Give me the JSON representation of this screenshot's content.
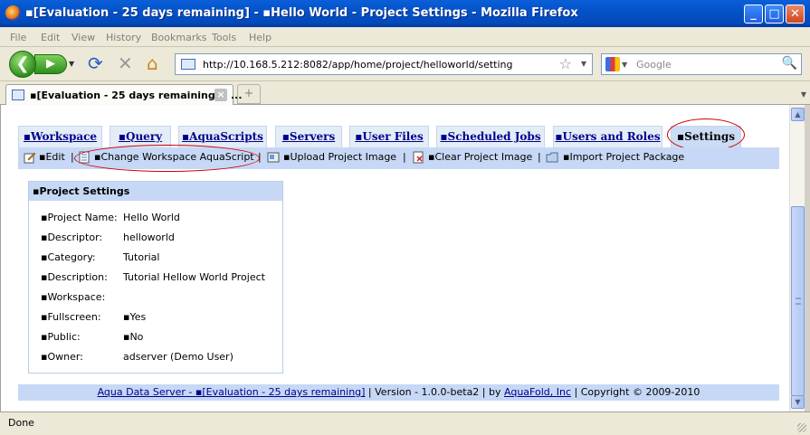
{
  "window": {
    "title": "▪[Evaluation - 25 days remaining] - ▪Hello World - Project Settings - Mozilla Firefox",
    "minimize": "_",
    "maximize": "□",
    "close": "✕"
  },
  "menu": [
    "File",
    "Edit",
    "View",
    "History",
    "Bookmarks",
    "Tools",
    "Help"
  ],
  "nav": {
    "url": "http://10.168.5.212:8082/app/home/project/helloworld/setting",
    "search_placeholder": "Google"
  },
  "browser_tab": {
    "label": "▪[Evaluation - 25 days remaining] - ...",
    "new_tab": "+"
  },
  "app_tabs": [
    {
      "label": "▪Workspace"
    },
    {
      "label": "▪Query"
    },
    {
      "label": "▪AquaScripts"
    },
    {
      "label": "▪Servers"
    },
    {
      "label": "▪User Files"
    },
    {
      "label": "▪Scheduled Jobs"
    },
    {
      "label": "▪Users and Roles"
    },
    {
      "label": "▪Settings"
    }
  ],
  "actions": [
    {
      "label": "▪Edit"
    },
    {
      "label": "▪Change Workspace AquaScript"
    },
    {
      "label": "▪Upload Project Image"
    },
    {
      "label": "▪Clear Project Image"
    },
    {
      "label": "▪Import Project Package"
    }
  ],
  "separator": "|",
  "settings": {
    "header": "▪Project Settings",
    "rows": [
      {
        "label": "▪Project Name:",
        "value": "Hello World"
      },
      {
        "label": "▪Descriptor:",
        "value": "helloworld"
      },
      {
        "label": "▪Category:",
        "value": "Tutorial"
      },
      {
        "label": "▪Description:",
        "value": "Tutorial Hellow World Project"
      },
      {
        "label": "▪Workspace:",
        "value": ""
      },
      {
        "label": "▪Fullscreen:",
        "value": "▪Yes"
      },
      {
        "label": "▪Public:",
        "value": "▪No"
      },
      {
        "label": "▪Owner:",
        "value": "adserver (Demo User)"
      }
    ]
  },
  "footer": {
    "link1": "Aqua Data Server - ▪[Evaluation - 25 days remaining]",
    "version": " | Version - 1.0.0-beta2 | by ",
    "link2": "AquaFold, Inc",
    "copyright": " | Copyright © 2009-2010"
  },
  "status": "Done"
}
